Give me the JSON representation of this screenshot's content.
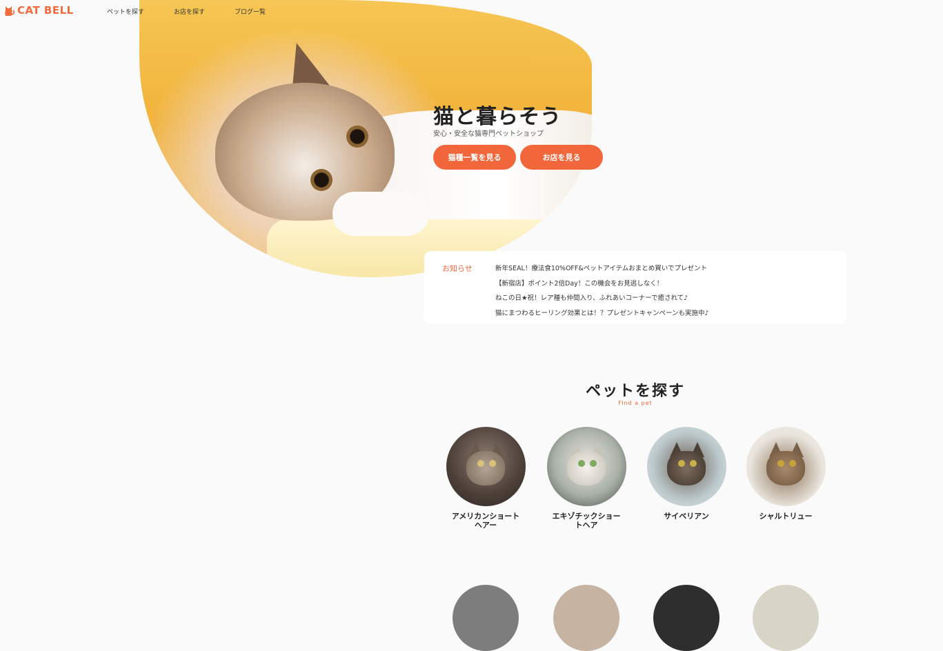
{
  "header": {
    "logo_text": "CAT BELL",
    "nav": [
      "ペットを探す",
      "お店を探す",
      "ブログ一覧"
    ]
  },
  "hero": {
    "title": "猫と暮らそう",
    "subtitle": "安心・安全な猫専門ペットショップ",
    "primary_button": "猫種一覧を見る",
    "secondary_button": "お店を見る"
  },
  "news": {
    "label": "お知らせ",
    "items": [
      "新年SEAL！療法食10%OFF&ペットアイテムおまとめ買いでプレゼント",
      "【新宿店】ポイント2倍Day！この機会をお見逃しなく！",
      "ねこの日★祝！レア種も仲間入り、ふれあいコーナーで癒されて♪",
      "猫にまつわるヒーリング効果とは！？プレゼントキャンペーンも実施中♪"
    ]
  },
  "find_pet": {
    "title": "ペットを探す",
    "subtitle": "Find a pet",
    "pets": [
      {
        "name": "アメリカンショートヘアー"
      },
      {
        "name": "エキゾチックショートヘア"
      },
      {
        "name": "サイベリアン"
      },
      {
        "name": "シャルトリュー"
      }
    ]
  },
  "colors": {
    "accent": "#f2663b",
    "background": "#fafafa",
    "hero_yellow": "#f1b23a"
  }
}
